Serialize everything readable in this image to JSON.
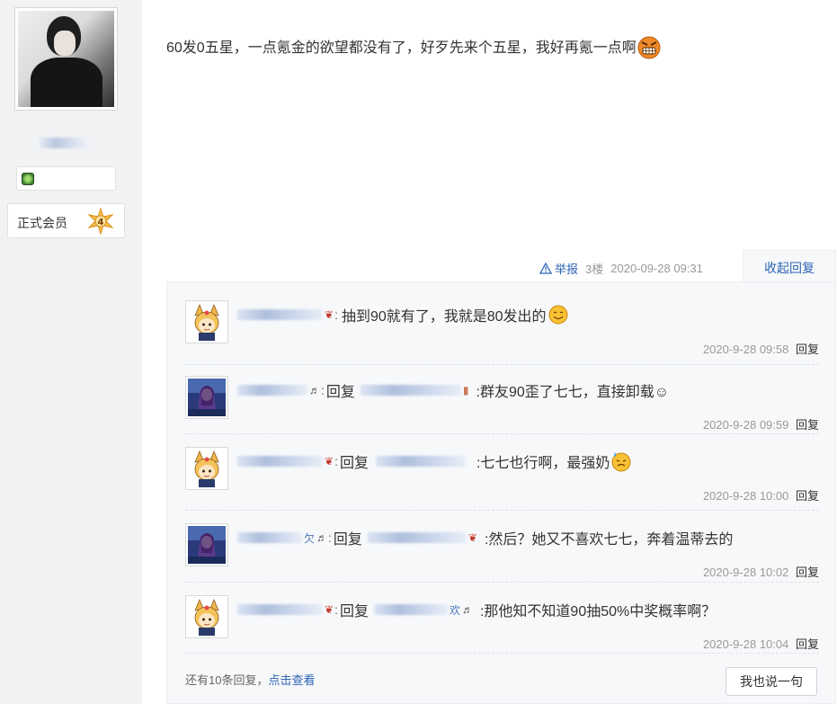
{
  "author": {
    "member_label": "正式会员",
    "level": "4"
  },
  "post": {
    "content": "60发0五星，一点氪金的欲望都没有了，好歹先来个五星，我好再氪一点啊",
    "report_label": "举报",
    "floor": "3楼",
    "time": "2020-09-28 09:31",
    "collapse_label": "收起回复"
  },
  "replies": [
    {
      "text": "抽到90就有了，我就是80发出的",
      "reply_prefix": "",
      "time": "2020-9-28 09:58",
      "reply_label": "回复"
    },
    {
      "text": ":群友90歪了七七，直接卸载☺",
      "reply_prefix": "回复",
      "time": "2020-9-28 09:59",
      "reply_label": "回复"
    },
    {
      "text": ":七七也行啊，最强奶",
      "reply_prefix": "回复",
      "time": "2020-9-28 10:00",
      "reply_label": "回复"
    },
    {
      "text": ":然后？她又不喜欢七七，奔着温蒂去的",
      "reply_prefix": "回复",
      "time": "2020-9-28 10:02",
      "reply_label": "回复"
    },
    {
      "text": ":那他知不知道90抽50%中奖概率啊？",
      "reply_prefix": "回复",
      "time": "2020-9-28 10:04",
      "reply_label": "回复"
    }
  ],
  "footer": {
    "more_text": "还有10条回复，",
    "view_link": "点击查看",
    "say_button": "我也说一句"
  },
  "colors": {
    "link": "#2d64b3",
    "panel_bg": "#f7f8fa",
    "sidebar_bg": "#f1f2f4",
    "meta_gray": "#999999"
  }
}
